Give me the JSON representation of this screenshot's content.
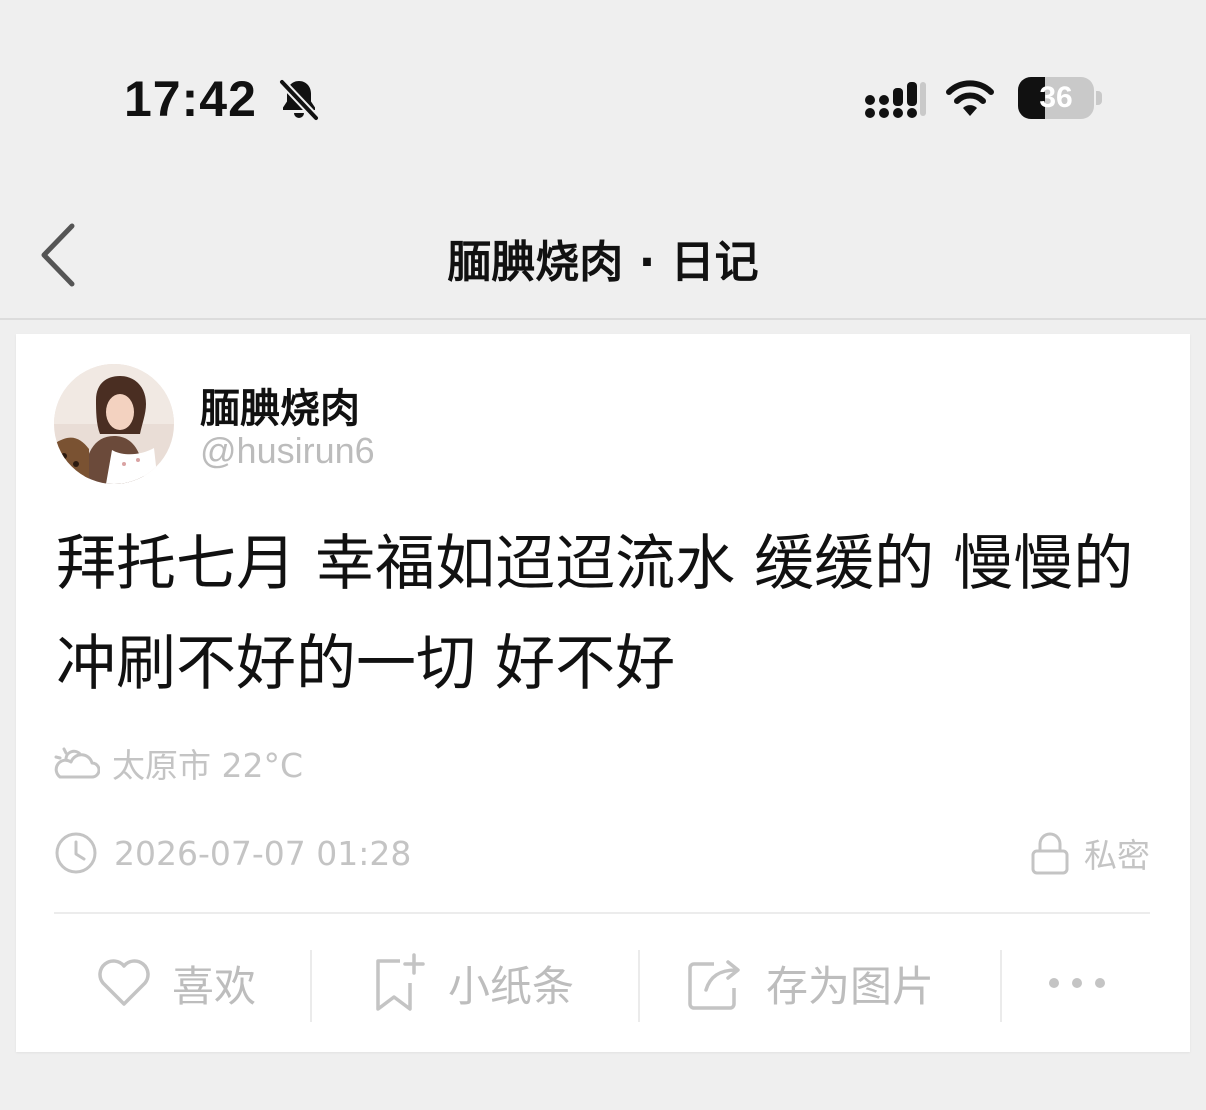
{
  "status_bar": {
    "time": "17:42",
    "battery_level": "36",
    "icons": [
      "bell-slash-icon",
      "cellular-signal-icon",
      "wifi-icon",
      "battery-icon"
    ]
  },
  "nav": {
    "back_icon": "chevron-left-icon",
    "title": "腼腆烧肉 · 日记"
  },
  "post": {
    "author_name": "腼腆烧肉",
    "author_handle": "@husirun6",
    "text": "拜托七月 幸福如迢迢流水 缓缓的 慢慢的 冲刷不好的一切 好不好",
    "weather_icon": "cloud-sun-icon",
    "weather": "太原市 22°C",
    "time_icon": "clock-icon",
    "datetime": "2026-07-07 01:28",
    "privacy_icon": "lock-icon",
    "privacy": "私密"
  },
  "actions": {
    "like": "喜欢",
    "note": "小纸条",
    "save_image": "存为图片",
    "more_icon": "more-dots-icon"
  },
  "colors": {
    "background": "#efefef",
    "card": "#ffffff",
    "muted": "#c4c4c4",
    "text": "#111111"
  }
}
